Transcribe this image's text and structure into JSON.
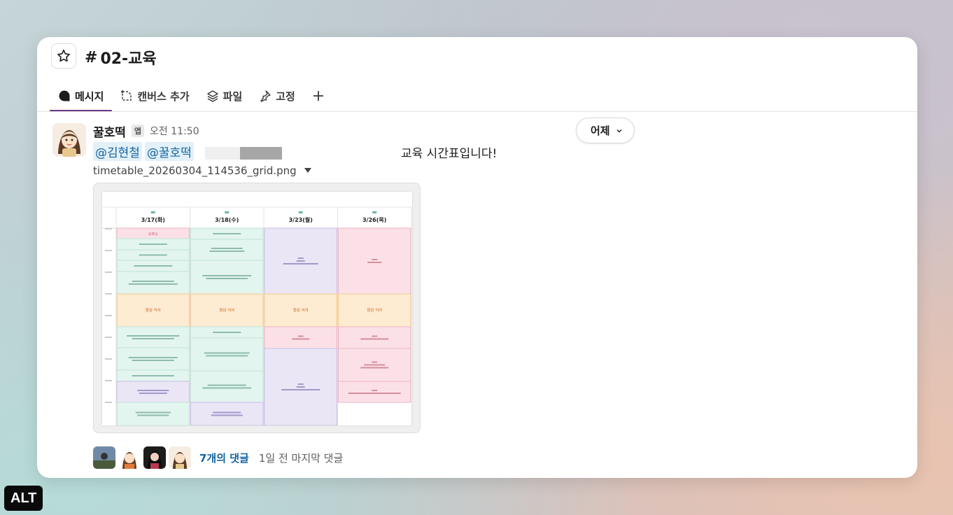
{
  "channel": {
    "hash": "#",
    "name": "02-교육"
  },
  "tabs": [
    {
      "label": "메시지",
      "icon": "message-bubble-icon",
      "active": true
    },
    {
      "label": "캔버스 추가",
      "icon": "canvas-add-icon",
      "active": false
    },
    {
      "label": "파일",
      "icon": "files-stack-icon",
      "active": false
    },
    {
      "label": "고정",
      "icon": "pin-icon",
      "active": false
    }
  ],
  "add_tab_icon": "plus-icon",
  "date_divider": {
    "label": "어제"
  },
  "message": {
    "sender": "꿀호떡",
    "badge": "앱",
    "time": "오전 11:50",
    "mentions": [
      "@김현철",
      "@꿀호떡"
    ],
    "text": "교육 시간표입니다!",
    "file_name": "timetable_20260304_114536_grid.png"
  },
  "timetable": {
    "columns": [
      "3/17(화)",
      "3/18(수)",
      "3/23(월)",
      "3/26(목)"
    ],
    "lunch_label": "점심 식사",
    "first_block_label": "오프닝"
  },
  "thread": {
    "count_label": "7개의 댓글",
    "last_label": "1일 전 마지막 댓글"
  },
  "alt_badge": "ALT",
  "colors": {
    "accent": "#6e3a86",
    "link": "#1264a3",
    "mention_bg": "#e2f0f8"
  }
}
